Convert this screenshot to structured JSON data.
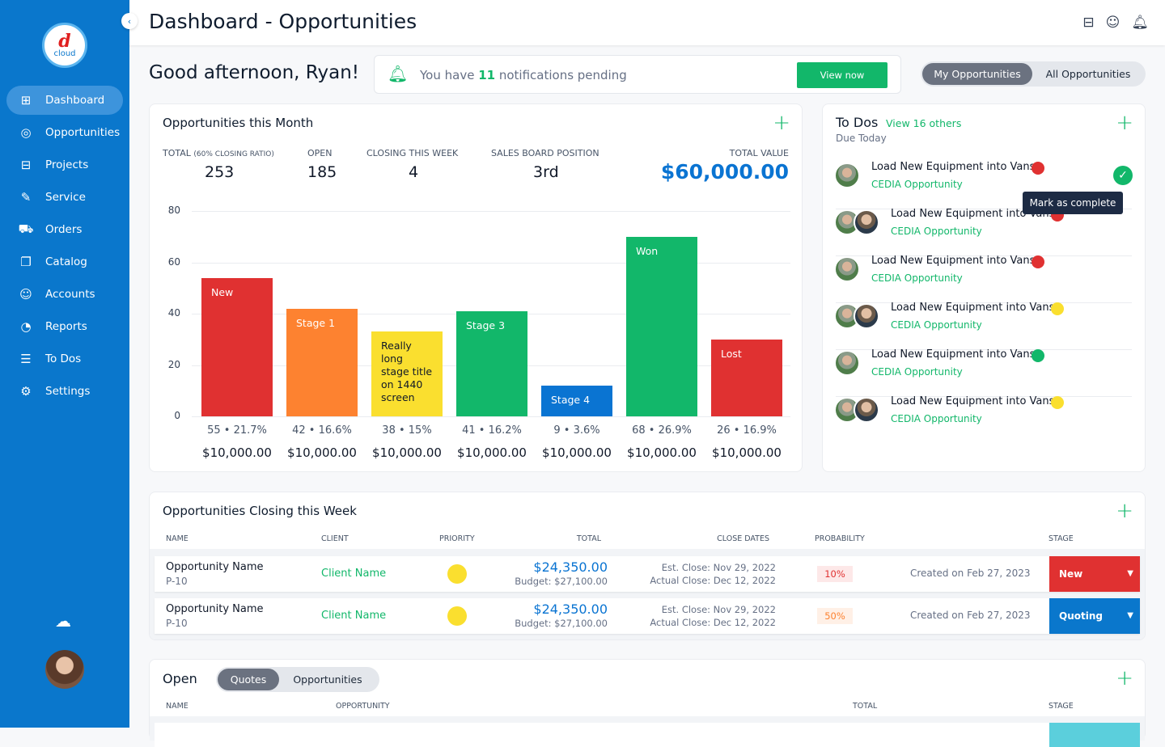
{
  "app": {
    "logo_text": "d cloud",
    "title": "Dashboard - Opportunities"
  },
  "sidebar": {
    "items": [
      {
        "label": "Dashboard",
        "icon": "grid-icon",
        "glyph": "⊞"
      },
      {
        "label": "Opportunities",
        "icon": "target-icon",
        "glyph": "◎"
      },
      {
        "label": "Projects",
        "icon": "briefcase-icon",
        "glyph": "⊟"
      },
      {
        "label": "Service",
        "icon": "wrench-icon",
        "glyph": "✎"
      },
      {
        "label": "Orders",
        "icon": "cart-icon",
        "glyph": "⛟"
      },
      {
        "label": "Catalog",
        "icon": "book-icon",
        "glyph": "❐"
      },
      {
        "label": "Accounts",
        "icon": "users-icon",
        "glyph": "☺"
      },
      {
        "label": "Reports",
        "icon": "pie-chart-icon",
        "glyph": "◔"
      },
      {
        "label": "To Dos",
        "icon": "list-icon",
        "glyph": "☰"
      },
      {
        "label": "Settings",
        "icon": "gear-icon",
        "glyph": "⚙"
      }
    ]
  },
  "greeting": "Good afternoon, Ryan!",
  "notification": {
    "prefix": "You have ",
    "count": "11",
    "suffix": " notifications pending",
    "button": "View now"
  },
  "toggle": {
    "options": [
      "My Opportunities",
      "All Opportunities"
    ],
    "selected": "My Opportunities"
  },
  "month": {
    "title": "Opportunities this Month",
    "stats": [
      {
        "label": "TOTAL",
        "sub": "(60% CLOSING RATIO)",
        "value": "253"
      },
      {
        "label": "OPEN",
        "value": "185"
      },
      {
        "label": "CLOSING THIS WEEK",
        "value": "4"
      },
      {
        "label": "SALES BOARD POSITION",
        "value": "3rd"
      },
      {
        "label": "TOTAL VALUE",
        "value": "$60,000.00"
      }
    ]
  },
  "chart_data": {
    "type": "bar",
    "ylim": [
      0,
      80
    ],
    "yticks": [
      0,
      20,
      40,
      60,
      80
    ],
    "grid": true,
    "categories": [
      "New",
      "Stage 1",
      "Really long stage title on 1440 screen",
      "Stage 3",
      "Stage 4",
      "Won",
      "Lost"
    ],
    "values": [
      54,
      42,
      33,
      41,
      12,
      70,
      30
    ],
    "colors": [
      "#e03131",
      "#fd8230",
      "#fadf2f",
      "#12b76a",
      "#0a74d2",
      "#12b76a",
      "#e03131"
    ],
    "counts": [
      "55",
      "42",
      "38",
      "41",
      "9",
      "68",
      "26"
    ],
    "percents": [
      "21.7%",
      "16.6%",
      "15%",
      "16.2%",
      "3.6%",
      "26.9%",
      "16.9%"
    ],
    "amounts": [
      "$10,000.00",
      "$10,000.00",
      "$10,000.00",
      "$10,000.00",
      "$10,000.00",
      "$10,000.00",
      "$10,000.00"
    ]
  },
  "todos": {
    "title": "To Dos",
    "view_others": "View 16 others",
    "subtitle": "Due Today",
    "tooltip": "Mark as complete",
    "items": [
      {
        "title": "Load New Equipment into Vans",
        "sub": "CEDIA Opportunity",
        "priority": "#e03131",
        "avatars": 1
      },
      {
        "title": "Load New Equipment into Vans",
        "sub": "CEDIA Opportunity",
        "priority": "#e03131",
        "avatars": 2
      },
      {
        "title": "Load New Equipment into Vans",
        "sub": "CEDIA Opportunity",
        "priority": "#e03131",
        "avatars": 1
      },
      {
        "title": "Load New Equipment into Vans",
        "sub": "CEDIA Opportunity",
        "priority": "#fadf2f",
        "avatars": 2
      },
      {
        "title": "Load New Equipment into Vans",
        "sub": "CEDIA Opportunity",
        "priority": "#12b76a",
        "avatars": 1
      },
      {
        "title": "Load New Equipment into Vans",
        "sub": "CEDIA Opportunity",
        "priority": "#fadf2f",
        "avatars": 2
      }
    ]
  },
  "closing": {
    "title": "Opportunities Closing this Week",
    "headers": [
      "NAME",
      "CLIENT",
      "PRIORITY",
      "TOTAL",
      "CLOSE DATES",
      "PROBABILITY",
      "STAGE"
    ],
    "rows": [
      {
        "name": "Opportunity Name",
        "id": "P-10",
        "client": "Client Name",
        "total": "$24,350.00",
        "budget": "Budget: $27,100.00",
        "est": "Est. Close: Nov 29, 2022",
        "actual": "Actual Close: Dec 12, 2022",
        "prob": "10%",
        "created": "Created on Feb 27, 2023",
        "stage": "New",
        "stage_color": "#e03131"
      },
      {
        "name": "Opportunity Name",
        "id": "P-10",
        "client": "Client Name",
        "total": "$24,350.00",
        "budget": "Budget: $27,100.00",
        "est": "Est. Close: Nov 29, 2022",
        "actual": "Actual Close: Dec 12, 2022",
        "prob": "50%",
        "created": "Created on Feb 27, 2023",
        "stage": "Quoting",
        "stage_color": "#0a77cc"
      }
    ]
  },
  "open": {
    "title": "Open",
    "tabs": [
      "Quotes",
      "Opportunities"
    ],
    "selected": "Quotes",
    "headers": [
      "NAME",
      "OPPORTUNITY",
      "TOTAL",
      "STAGE"
    ]
  }
}
